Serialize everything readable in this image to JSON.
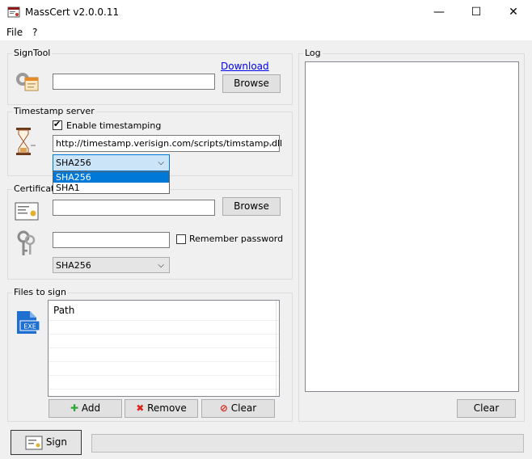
{
  "window": {
    "title": "MassCert v2.0.0.11",
    "min": "—",
    "max": "☐",
    "close": "✕"
  },
  "menu": {
    "items": [
      "File",
      "?"
    ]
  },
  "signtool": {
    "title": "SignTool",
    "download_label": "Download",
    "path_value": "",
    "browse_label": "Browse"
  },
  "timestamp": {
    "title": "Timestamp server",
    "enable_label": "Enable timestamping",
    "enable_checked": true,
    "url_value": "http://timestamp.verisign.com/scripts/timstamp.dll",
    "hash_selected": "SHA256",
    "hash_options": [
      "SHA256",
      "SHA1"
    ]
  },
  "certificate": {
    "title": "Certificate",
    "path_value": "",
    "browse_label": "Browse",
    "password_value": "",
    "remember_label": "Remember password",
    "hash_selected": "SHA256"
  },
  "files": {
    "title": "Files to sign",
    "column_path": "Path",
    "add_label": "Add",
    "remove_label": "Remove",
    "clear_label": "Clear"
  },
  "log": {
    "title": "Log",
    "clear_label": "Clear"
  },
  "bottom": {
    "sign_label": "Sign"
  },
  "icons": {
    "check": "✔",
    "chevron": "⌵",
    "add": "✚",
    "remove": "✖",
    "clear": "⊘"
  },
  "colors": {
    "highlight": "#0078d7",
    "highlight_bg": "#cce4f7",
    "link": "#0000ee"
  }
}
